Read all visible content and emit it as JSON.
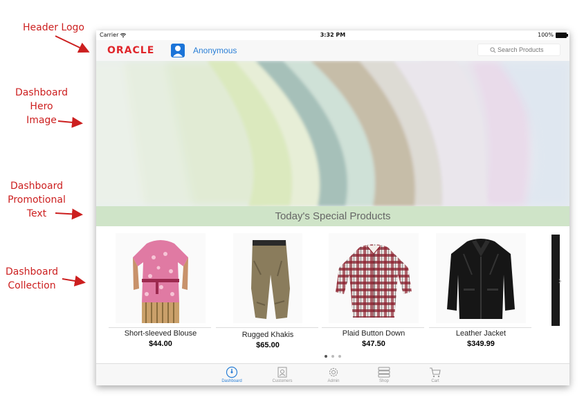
{
  "annotations": [
    {
      "id": "header-logo",
      "lines": [
        "Header Logo"
      ]
    },
    {
      "id": "hero",
      "lines": [
        "Dashboard",
        "Hero",
        "Image"
      ]
    },
    {
      "id": "promo",
      "lines": [
        "Dashboard",
        "Promotional",
        "Text"
      ]
    },
    {
      "id": "collection",
      "lines": [
        "Dashboard",
        "Collection"
      ]
    }
  ],
  "status_bar": {
    "carrier": "Carrier",
    "time": "3:32 PM",
    "battery": "100%"
  },
  "header": {
    "logo": "ORACLE",
    "user": "Anonymous",
    "search_placeholder": "Search Products"
  },
  "promo": {
    "text": "Today's Special Products"
  },
  "products": [
    {
      "name": "Short-sleeved Blouse",
      "price": "$44.00"
    },
    {
      "name": "Rugged Khakis",
      "price": "$65.00"
    },
    {
      "name": "Plaid Button Down",
      "price": "$47.50"
    },
    {
      "name": "Leather Jacket",
      "price": "$349.99"
    }
  ],
  "pager": {
    "pages": 3,
    "active": 0
  },
  "tabs": [
    {
      "label": "Dashboard",
      "icon": "dashboard-icon",
      "active": true
    },
    {
      "label": "Customers",
      "icon": "customers-icon",
      "active": false
    },
    {
      "label": "Admin",
      "icon": "gear-icon",
      "active": false
    },
    {
      "label": "Shop",
      "icon": "shop-icon",
      "active": false
    },
    {
      "label": "Cart",
      "icon": "cart-icon",
      "active": false
    }
  ],
  "colors": {
    "annotation_red": "#cc1f1f",
    "oracle_red": "#e0262b",
    "accent_blue": "#2a7fd6",
    "promo_bg": "#cfe4c8"
  }
}
